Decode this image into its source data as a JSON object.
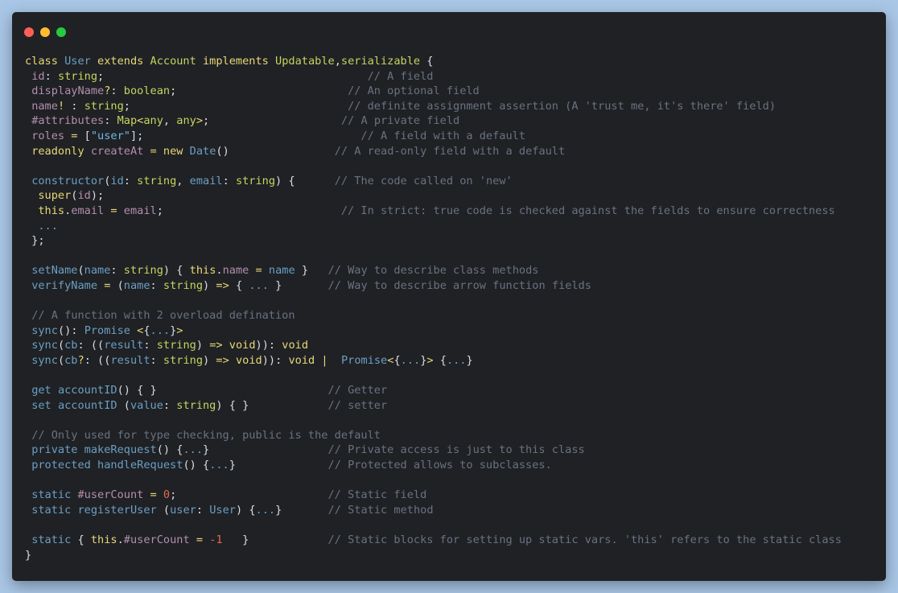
{
  "window": {
    "controls": [
      {
        "name": "close",
        "color": "#ff5f56"
      },
      {
        "name": "minimize",
        "color": "#ffbd2e"
      },
      {
        "name": "maximize",
        "color": "#27c93f"
      }
    ]
  },
  "code_lines": [
    [
      [
        "k",
        "class "
      ],
      [
        "c",
        "User "
      ],
      [
        "k",
        "extends "
      ],
      [
        "t",
        "Account "
      ],
      [
        "k",
        "implements "
      ],
      [
        "t",
        "Updatable"
      ],
      [
        "",
        ","
      ],
      [
        "t",
        "serializable "
      ],
      [
        "",
        "{"
      ]
    ],
    [
      [
        "",
        " "
      ],
      [
        "p",
        "id"
      ],
      [
        "",
        ": "
      ],
      [
        "t",
        "string"
      ],
      [
        "",
        ";                                        "
      ],
      [
        "cm",
        "// A field"
      ]
    ],
    [
      [
        "",
        " "
      ],
      [
        "p",
        "displayName"
      ],
      [
        "k",
        "?"
      ],
      [
        "",
        ": "
      ],
      [
        "t",
        "boolean"
      ],
      [
        "",
        ";                          "
      ],
      [
        "cm",
        "// An optional field"
      ]
    ],
    [
      [
        "",
        " "
      ],
      [
        "p",
        "name"
      ],
      [
        "k",
        "!"
      ],
      [
        "",
        " : "
      ],
      [
        "t",
        "string"
      ],
      [
        "",
        ";                                 "
      ],
      [
        "cm",
        "// definite assignment assertion (A 'trust me, it's there' field)"
      ]
    ],
    [
      [
        "",
        " "
      ],
      [
        "p",
        "#attributes"
      ],
      [
        "",
        ": "
      ],
      [
        "t",
        "Map"
      ],
      [
        "k",
        "<"
      ],
      [
        "t",
        "any"
      ],
      [
        "",
        ", "
      ],
      [
        "t",
        "any"
      ],
      [
        "k",
        ">"
      ],
      [
        "",
        ";                    "
      ],
      [
        "cm",
        "// A private field"
      ]
    ],
    [
      [
        "",
        " "
      ],
      [
        "p",
        "roles "
      ],
      [
        "k",
        "= "
      ],
      [
        "",
        "["
      ],
      [
        "s",
        "\"user\""
      ],
      [
        "",
        "];                                 "
      ],
      [
        "cm",
        "// A field with a default"
      ]
    ],
    [
      [
        "",
        " "
      ],
      [
        "k",
        "readonly "
      ],
      [
        "p",
        "createAt "
      ],
      [
        "k",
        "= "
      ],
      [
        "k",
        "new "
      ],
      [
        "c",
        "Date"
      ],
      [
        "",
        "()                "
      ],
      [
        "cm",
        "// A read-only field with a default"
      ]
    ],
    [
      [
        "",
        ""
      ]
    ],
    [
      [
        "",
        " "
      ],
      [
        "c",
        "constructor"
      ],
      [
        "",
        "("
      ],
      [
        "c",
        "id"
      ],
      [
        "",
        ": "
      ],
      [
        "t",
        "string"
      ],
      [
        "",
        ", "
      ],
      [
        "c",
        "email"
      ],
      [
        "",
        ": "
      ],
      [
        "t",
        "string"
      ],
      [
        "",
        ") {      "
      ],
      [
        "cm",
        "// The code called on 'new'"
      ]
    ],
    [
      [
        "",
        "  "
      ],
      [
        "k",
        "super"
      ],
      [
        "",
        "("
      ],
      [
        "p",
        "id"
      ],
      [
        "",
        ");"
      ]
    ],
    [
      [
        "",
        "  "
      ],
      [
        "k",
        "this"
      ],
      [
        "",
        "."
      ],
      [
        "p",
        "email "
      ],
      [
        "k",
        "= "
      ],
      [
        "p",
        "email"
      ],
      [
        "",
        ";                           "
      ],
      [
        "cm",
        "// In strict: true code is checked against the fields to ensure correctness"
      ]
    ],
    [
      [
        "",
        "  "
      ],
      [
        "c",
        "..."
      ]
    ],
    [
      [
        "",
        " };"
      ]
    ],
    [
      [
        "",
        ""
      ]
    ],
    [
      [
        "",
        " "
      ],
      [
        "c",
        "setName"
      ],
      [
        "",
        "("
      ],
      [
        "c",
        "name"
      ],
      [
        "",
        ": "
      ],
      [
        "t",
        "string"
      ],
      [
        "",
        ") { "
      ],
      [
        "k",
        "this"
      ],
      [
        "",
        "."
      ],
      [
        "p",
        "name "
      ],
      [
        "k",
        "= "
      ],
      [
        "c",
        "name "
      ],
      [
        "",
        "}   "
      ],
      [
        "cm",
        "// Way to describe class methods"
      ]
    ],
    [
      [
        "",
        " "
      ],
      [
        "c",
        "verifyName "
      ],
      [
        "k",
        "= "
      ],
      [
        "",
        "("
      ],
      [
        "c",
        "name"
      ],
      [
        "",
        ": "
      ],
      [
        "t",
        "string"
      ],
      [
        "",
        ") "
      ],
      [
        "k",
        "=> "
      ],
      [
        "",
        "{ "
      ],
      [
        "c",
        "..."
      ],
      [
        "",
        " }       "
      ],
      [
        "cm",
        "// Way to describe arrow function fields"
      ]
    ],
    [
      [
        "",
        ""
      ]
    ],
    [
      [
        "",
        " "
      ],
      [
        "cm",
        "// A function with 2 overload defination"
      ]
    ],
    [
      [
        "",
        " "
      ],
      [
        "c",
        "sync"
      ],
      [
        "",
        "(): "
      ],
      [
        "c",
        "Promise "
      ],
      [
        "k",
        "<"
      ],
      [
        "",
        "{"
      ],
      [
        "c",
        "..."
      ],
      [
        "",
        "}"
      ],
      [
        "k",
        ">"
      ]
    ],
    [
      [
        "",
        " "
      ],
      [
        "c",
        "sync"
      ],
      [
        "",
        "("
      ],
      [
        "c",
        "cb"
      ],
      [
        "",
        ": (("
      ],
      [
        "c",
        "result"
      ],
      [
        "",
        ": "
      ],
      [
        "t",
        "string"
      ],
      [
        "",
        ") "
      ],
      [
        "k",
        "=> "
      ],
      [
        "k",
        "void"
      ],
      [
        "",
        ")): "
      ],
      [
        "k",
        "void"
      ]
    ],
    [
      [
        "",
        " "
      ],
      [
        "c",
        "sync"
      ],
      [
        "",
        "("
      ],
      [
        "c",
        "cb"
      ],
      [
        "k",
        "?"
      ],
      [
        "",
        ": (("
      ],
      [
        "c",
        "result"
      ],
      [
        "",
        ": "
      ],
      [
        "t",
        "string"
      ],
      [
        "",
        ") "
      ],
      [
        "k",
        "=> "
      ],
      [
        "k",
        "void"
      ],
      [
        "",
        ")): "
      ],
      [
        "k",
        "void "
      ],
      [
        "k",
        "| "
      ],
      [
        "",
        " "
      ],
      [
        "c",
        "Promise"
      ],
      [
        "k",
        "<"
      ],
      [
        "",
        "{"
      ],
      [
        "c",
        "..."
      ],
      [
        "",
        "}"
      ],
      [
        "k",
        "> "
      ],
      [
        "",
        "{"
      ],
      [
        "c",
        "..."
      ],
      [
        "",
        "}"
      ]
    ],
    [
      [
        "",
        ""
      ]
    ],
    [
      [
        "",
        " "
      ],
      [
        "c",
        "get "
      ],
      [
        "c",
        "accountID"
      ],
      [
        "",
        "() { }                          "
      ],
      [
        "cm",
        "// Getter"
      ]
    ],
    [
      [
        "",
        " "
      ],
      [
        "c",
        "set "
      ],
      [
        "c",
        "accountID "
      ],
      [
        "",
        "("
      ],
      [
        "c",
        "value"
      ],
      [
        "",
        ": "
      ],
      [
        "t",
        "string"
      ],
      [
        "",
        ") { }            "
      ],
      [
        "cm",
        "// setter"
      ]
    ],
    [
      [
        "",
        ""
      ]
    ],
    [
      [
        "",
        " "
      ],
      [
        "cm",
        "// Only used for type checking, public is the default"
      ]
    ],
    [
      [
        "",
        " "
      ],
      [
        "c",
        "private "
      ],
      [
        "c",
        "makeRequest"
      ],
      [
        "",
        "() {"
      ],
      [
        "c",
        "..."
      ],
      [
        "",
        "}                  "
      ],
      [
        "cm",
        "// Private access is just to this class"
      ]
    ],
    [
      [
        "",
        " "
      ],
      [
        "c",
        "protected "
      ],
      [
        "c",
        "handleRequest"
      ],
      [
        "",
        "() {"
      ],
      [
        "c",
        "..."
      ],
      [
        "",
        "}              "
      ],
      [
        "cm",
        "// Protected allows to subclasses."
      ]
    ],
    [
      [
        "",
        ""
      ]
    ],
    [
      [
        "",
        " "
      ],
      [
        "c",
        "static "
      ],
      [
        "p",
        "#userCount "
      ],
      [
        "k",
        "= "
      ],
      [
        "n",
        "0"
      ],
      [
        "",
        ";                       "
      ],
      [
        "cm",
        "// Static field"
      ]
    ],
    [
      [
        "",
        " "
      ],
      [
        "c",
        "static "
      ],
      [
        "c",
        "registerUser "
      ],
      [
        "",
        "("
      ],
      [
        "c",
        "user"
      ],
      [
        "",
        ": "
      ],
      [
        "c",
        "User"
      ],
      [
        "",
        ") {"
      ],
      [
        "c",
        "..."
      ],
      [
        "",
        "}       "
      ],
      [
        "cm",
        "// Static method"
      ]
    ],
    [
      [
        "",
        ""
      ]
    ],
    [
      [
        "",
        " "
      ],
      [
        "c",
        "static "
      ],
      [
        "",
        "{ "
      ],
      [
        "k",
        "this"
      ],
      [
        "",
        "."
      ],
      [
        "p",
        "#userCount "
      ],
      [
        "k",
        "= "
      ],
      [
        "n",
        "-1   "
      ],
      [
        "",
        "}            "
      ],
      [
        "cm",
        "// Static blocks for setting up static vars. 'this' refers to the static class"
      ]
    ],
    [
      [
        "",
        "}"
      ]
    ]
  ]
}
